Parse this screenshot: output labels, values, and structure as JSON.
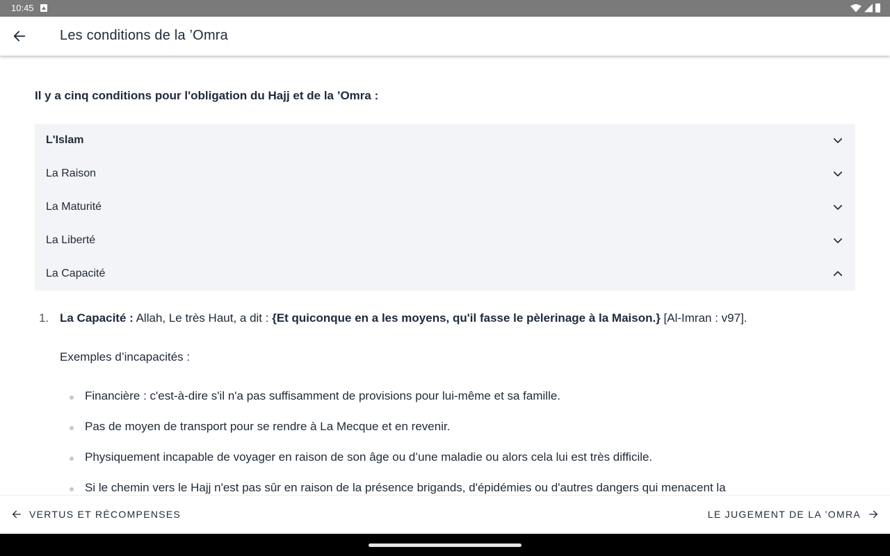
{
  "status_bar": {
    "time": "10:45"
  },
  "app_bar": {
    "title": "Les conditions de la ’Omra"
  },
  "intro": "Il y a cinq conditions pour l'obligation du Hajj et de la ’Omra :",
  "accordion": [
    {
      "label": "L'Islam",
      "state": "collapsed",
      "emphasis": "bold"
    },
    {
      "label": "La Raison",
      "state": "collapsed"
    },
    {
      "label": "La Maturité",
      "state": "collapsed"
    },
    {
      "label": "La Liberté",
      "state": "collapsed"
    },
    {
      "label": "La Capacité",
      "state": "expanded"
    }
  ],
  "details": {
    "number": "1.",
    "heading": "La Capacité :",
    "intro_text": " Allah, Le très Haut, a dit : ",
    "quote": "{Et quiconque en a les moyens, qu'il fasse le pèlerinage à la Maison.}",
    "reference": " [Al-Imran : v97].",
    "examples_label": "Exemples d’incapacités :",
    "bullets": [
      "Financière : c'est-à-dire s'il n'a pas suffisamment de provisions pour lui-même et sa famille.",
      "Pas de moyen de transport pour se rendre à La Mecque et en revenir.",
      "Physiquement incapable de voyager en raison de son âge ou d’une maladie ou alors cela lui est très difficile.",
      "Si le chemin vers le Hajj n'est pas sûr en raison de la présence brigands, d'épidémies ou d'autres dangers qui menacent la"
    ]
  },
  "bottom_nav": {
    "prev_label": "VERTUS ET RÉCOMPENSES",
    "next_label": "LE JUGEMENT DE LA ’OMRA"
  }
}
